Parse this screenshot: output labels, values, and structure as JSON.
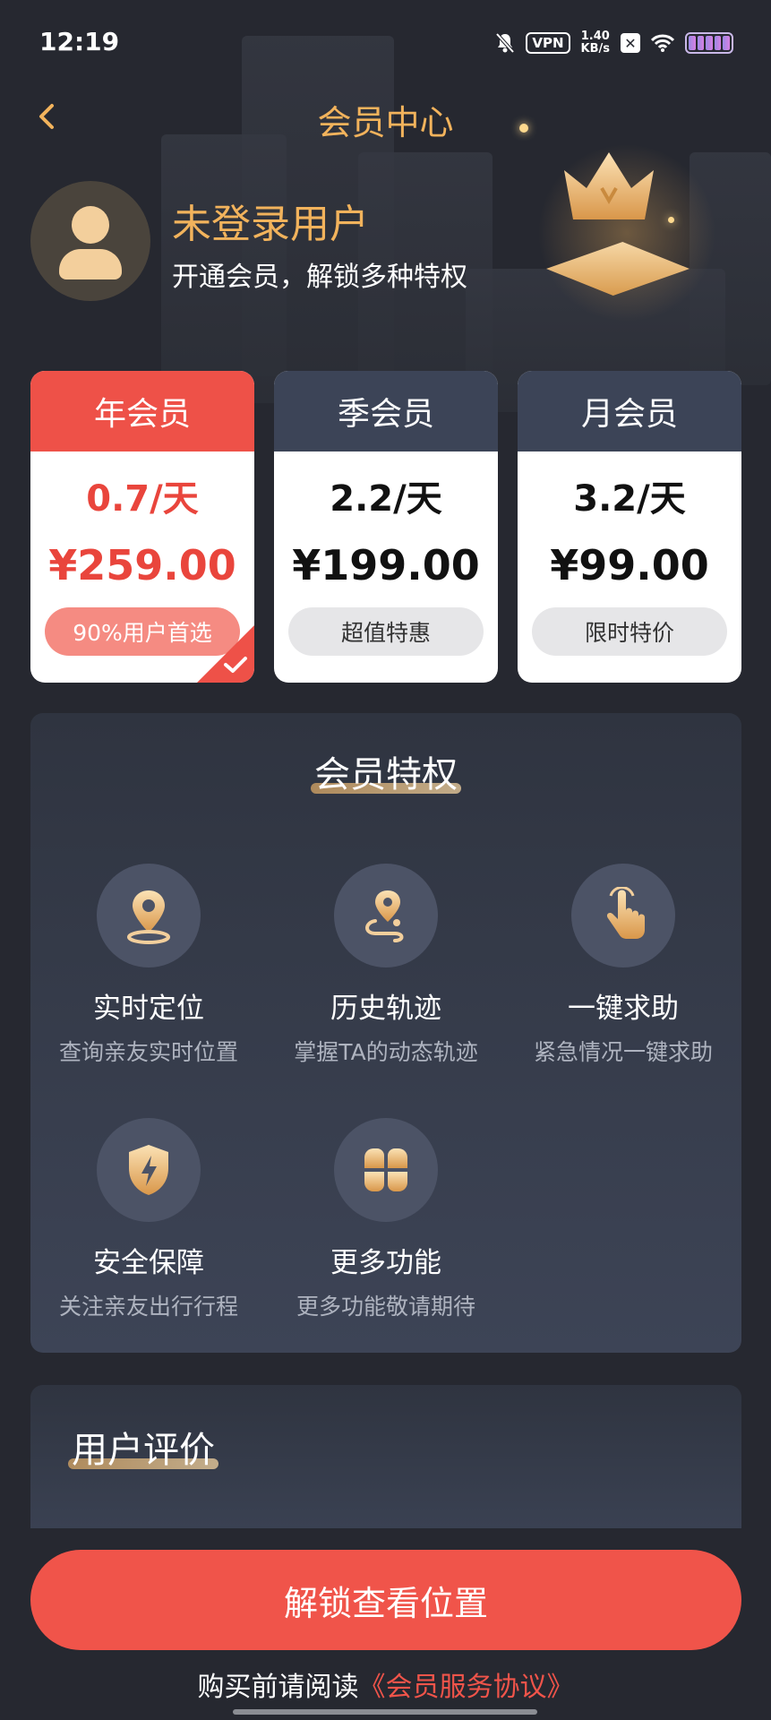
{
  "status_bar": {
    "time": "12:19",
    "vpn": "VPN",
    "speed_value": "1.40",
    "speed_unit": "KB/s",
    "icons": [
      "mute-bell-icon",
      "vpn-icon",
      "network-speed",
      "x-app-icon",
      "wifi-icon",
      "battery-icon"
    ]
  },
  "header": {
    "back_icon": "chevron-left-icon",
    "title": "会员中心"
  },
  "user": {
    "name": "未登录用户",
    "subtitle": "开通会员，解锁多种特权"
  },
  "plans": [
    {
      "name": "年会员",
      "daily": "0.7/天",
      "price": "¥259.00",
      "tag": "90%用户首选",
      "selected": true
    },
    {
      "name": "季会员",
      "daily": "2.2/天",
      "price": "¥199.00",
      "tag": "超值特惠",
      "selected": false
    },
    {
      "name": "月会员",
      "daily": "3.2/天",
      "price": "¥99.00",
      "tag": "限时特价",
      "selected": false
    }
  ],
  "privileges": {
    "title": "会员特权",
    "items": [
      {
        "name": "实时定位",
        "desc": "查询亲友实时位置",
        "icon": "location-pin-icon"
      },
      {
        "name": "历史轨迹",
        "desc": "掌握TA的动态轨迹",
        "icon": "route-icon"
      },
      {
        "name": "一键求助",
        "desc": "紧急情况一键求助",
        "icon": "tap-hand-icon"
      },
      {
        "name": "安全保障",
        "desc": "关注亲友出行行程",
        "icon": "shield-bolt-icon"
      },
      {
        "name": "更多功能",
        "desc": "更多功能敬请期待",
        "icon": "grid-clover-icon"
      }
    ]
  },
  "reviews": {
    "title": "用户评价"
  },
  "cta": {
    "label": "解锁查看位置"
  },
  "agreement": {
    "prefix": "购买前请阅读",
    "link": "《会员服务协议》"
  },
  "colors": {
    "accent_gold": "#f2b35c",
    "accent_red": "#ee5148",
    "background": "#262830"
  }
}
